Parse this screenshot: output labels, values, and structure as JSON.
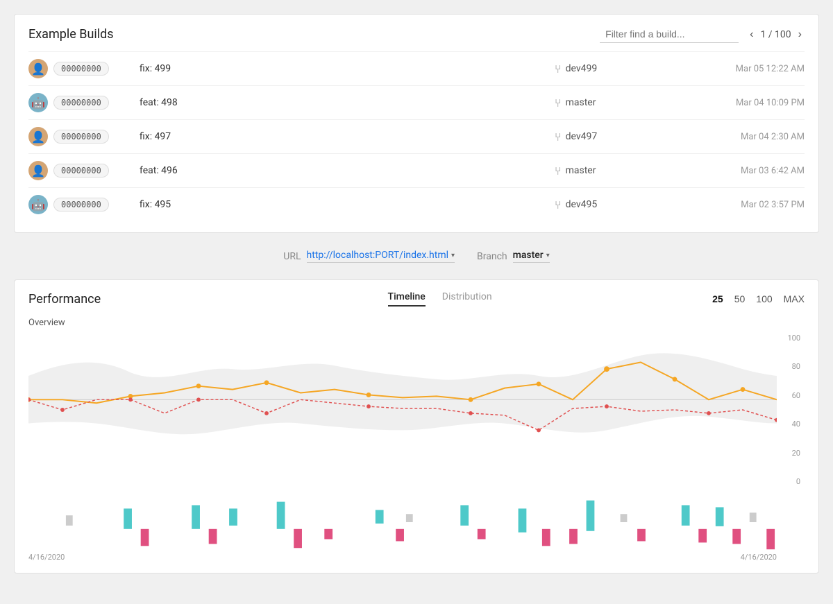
{
  "buildsPanel": {
    "title": "Example Builds",
    "filter": {
      "placeholder": "Filter find a build..."
    },
    "pagination": {
      "current": 1,
      "total": 100,
      "label": "1 / 100"
    },
    "rows": [
      {
        "id": "00000000",
        "avatarType": "human",
        "avatarEmoji": "👤",
        "message": "fix: 499",
        "branch": "dev499",
        "date": "Mar 05 12:22 AM"
      },
      {
        "id": "00000000",
        "avatarType": "robot",
        "avatarEmoji": "🤖",
        "message": "feat: 498",
        "branch": "master",
        "date": "Mar 04 10:09 PM"
      },
      {
        "id": "00000000",
        "avatarType": "human",
        "avatarEmoji": "👤",
        "message": "fix: 497",
        "branch": "dev497",
        "date": "Mar 04 2:30 AM"
      },
      {
        "id": "00000000",
        "avatarType": "human",
        "avatarEmoji": "👤",
        "message": "feat: 496",
        "branch": "master",
        "date": "Mar 03 6:42 AM"
      },
      {
        "id": "00000000",
        "avatarType": "robot",
        "avatarEmoji": "🤖",
        "message": "fix: 495",
        "branch": "dev495",
        "date": "Mar 02 3:57 PM"
      }
    ]
  },
  "configBar": {
    "urlLabel": "URL",
    "urlValue": "http://localhost:PORT/index.html",
    "branchLabel": "Branch",
    "branchValue": "master"
  },
  "performance": {
    "title": "Performance",
    "tabs": [
      {
        "label": "Timeline",
        "active": true
      },
      {
        "label": "Distribution",
        "active": false
      }
    ],
    "countButtons": [
      {
        "label": "25",
        "active": true
      },
      {
        "label": "50",
        "active": false
      },
      {
        "label": "100",
        "active": false
      },
      {
        "label": "MAX",
        "active": false
      }
    ],
    "overviewLabel": "Overview",
    "yAxisLabels": [
      "100",
      "80",
      "60",
      "40",
      "20",
      "0"
    ],
    "dateLabels": {
      "start": "4/16/2020",
      "end": "4/16/2020"
    }
  },
  "icons": {
    "chevronLeft": "‹",
    "chevronRight": "›",
    "branchSymbol": "⌥",
    "dropdownArrow": "▾"
  }
}
